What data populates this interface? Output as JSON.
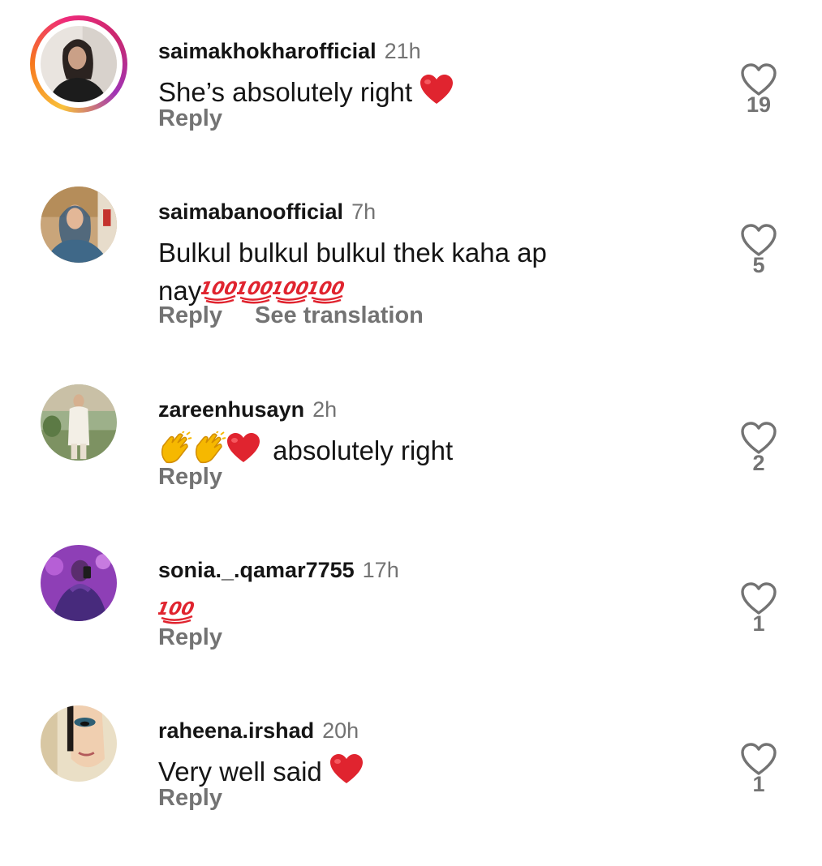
{
  "comments": [
    {
      "username": "saimakhokharofficial",
      "time": "21h",
      "text": "She’s absolutely right",
      "reply_label": "Reply",
      "likes": "19",
      "has_story": true
    },
    {
      "username": "saimabanoofficial",
      "time": "7h",
      "text_line1": "Bulkul bulkul bulkul thek kaha ap",
      "text_line2": "nay",
      "reply_label": "Reply",
      "translate_label": "See translation",
      "likes": "5",
      "has_story": false
    },
    {
      "username": "zareenhusayn",
      "time": "2h",
      "text": "absolutely right",
      "reply_label": "Reply",
      "likes": "2",
      "has_story": false
    },
    {
      "username": "sonia._.qamar7755",
      "time": "17h",
      "reply_label": "Reply",
      "likes": "1",
      "has_story": false
    },
    {
      "username": "raheena.irshad",
      "time": "20h",
      "text": "Very well said",
      "reply_label": "Reply",
      "likes": "1",
      "has_story": false
    }
  ],
  "icons": {
    "like": "heart-outline-icon",
    "emoji_heart": "red-heart-emoji",
    "emoji_hundred": "hundred-points-emoji",
    "emoji_clap": "clapping-hands-emoji"
  },
  "colors": {
    "username": "#151515",
    "secondary": "#737373",
    "emoji_red": "#e0242f"
  }
}
